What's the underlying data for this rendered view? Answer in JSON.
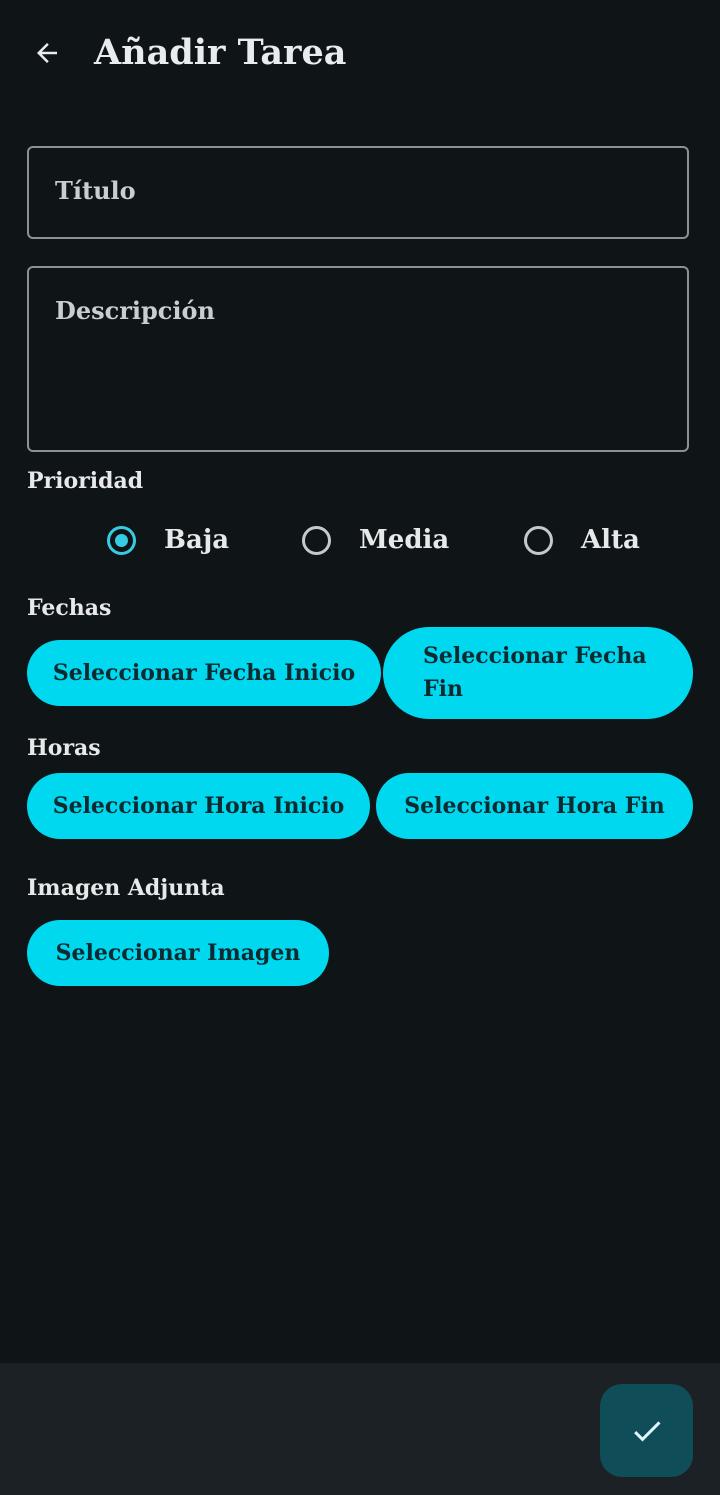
{
  "appbar": {
    "back_icon": "arrow-back-icon",
    "title": "Añadir Tarea"
  },
  "form": {
    "title_placeholder": "Título",
    "description_placeholder": "Descripción"
  },
  "priority": {
    "label": "Prioridad",
    "options": [
      {
        "label": "Baja",
        "selected": true
      },
      {
        "label": "Media",
        "selected": false
      },
      {
        "label": "Alta",
        "selected": false
      }
    ]
  },
  "dates": {
    "label": "Fechas",
    "start_button": "Seleccionar Fecha Inicio",
    "end_button": "Seleccionar Fecha Fin"
  },
  "hours": {
    "label": "Horas",
    "start_button": "Seleccionar Hora Inicio",
    "end_button": "Seleccionar Hora Fin"
  },
  "image": {
    "label": "Imagen Adjunta",
    "button": "Seleccionar Imagen"
  },
  "fab": {
    "icon": "check-icon"
  },
  "colors": {
    "background": "#0f1417",
    "accent": "#00d8ef",
    "radio_selected": "#36cde2",
    "fab_background": "#0f4e59",
    "bottom_bar": "#1b2124"
  }
}
